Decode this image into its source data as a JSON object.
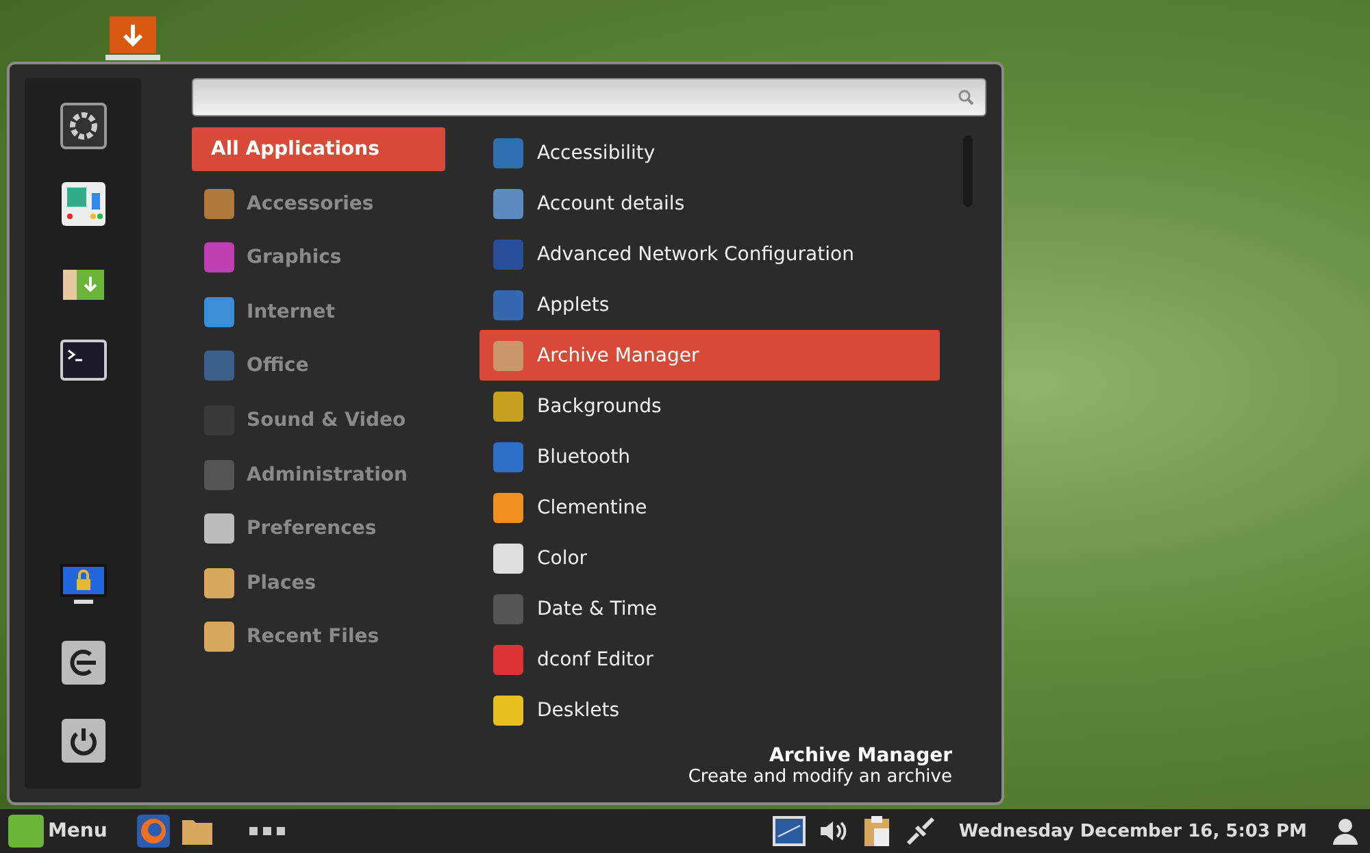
{
  "categories": [
    {
      "label": "All Applications",
      "selected": true
    },
    {
      "label": "Accessories",
      "selected": false
    },
    {
      "label": "Graphics",
      "selected": false
    },
    {
      "label": "Internet",
      "selected": false
    },
    {
      "label": "Office",
      "selected": false
    },
    {
      "label": "Sound & Video",
      "selected": false
    },
    {
      "label": "Administration",
      "selected": false
    },
    {
      "label": "Preferences",
      "selected": false
    },
    {
      "label": "Places",
      "selected": false
    },
    {
      "label": "Recent Files",
      "selected": false
    }
  ],
  "applications": [
    {
      "label": "Accessibility",
      "selected": false
    },
    {
      "label": "Account details",
      "selected": false
    },
    {
      "label": "Advanced Network Configuration",
      "selected": false
    },
    {
      "label": "Applets",
      "selected": false
    },
    {
      "label": "Archive Manager",
      "selected": true
    },
    {
      "label": "Backgrounds",
      "selected": false
    },
    {
      "label": "Bluetooth",
      "selected": false
    },
    {
      "label": "Clementine",
      "selected": false
    },
    {
      "label": "Color",
      "selected": false
    },
    {
      "label": "Date & Time",
      "selected": false
    },
    {
      "label": "dconf Editor",
      "selected": false
    },
    {
      "label": "Desklets",
      "selected": false
    }
  ],
  "description": {
    "title": "Archive Manager",
    "text": "Create and modify an archive"
  },
  "taskbar": {
    "menu_label": "Menu",
    "clock": "Wednesday December 16,  5:03 PM"
  }
}
